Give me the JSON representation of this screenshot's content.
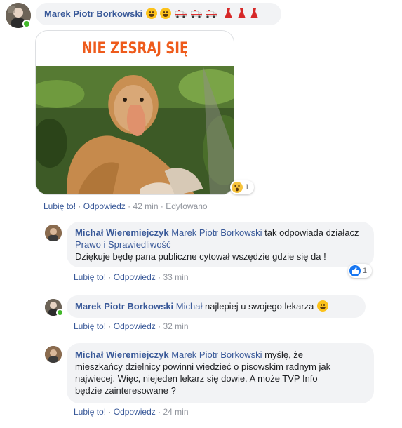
{
  "comment1": {
    "author": "Marek Piotr Borkowski",
    "emoji_sequence": [
      "grinning-face",
      "grinning-face",
      "ambulance",
      "ambulance",
      "ambulance",
      "red-dress",
      "red-dress",
      "red-dress"
    ],
    "image_caption": "NIE ZESRAJ SIĘ",
    "reaction": {
      "icon": "wow-face",
      "count": "1"
    },
    "actions": {
      "like": "Lubię to!",
      "reply": "Odpowiedz",
      "time": "42 min",
      "edited": "Edytowano"
    }
  },
  "reply1": {
    "author": "Michał Wieremiejczyk",
    "mention": "Marek Piotr Borkowski",
    "text_a": "tak odpowiada działacz",
    "page_link": "Prawo i Sprawiedliwość",
    "text_b": "Dziękuje będę pana publiczne cytował wszędzie gdzie się da !",
    "reaction": {
      "icon": "like-thumb",
      "count": "1"
    },
    "actions": {
      "like": "Lubię to!",
      "reply": "Odpowiedz",
      "time": "33 min"
    }
  },
  "reply2": {
    "author": "Marek Piotr Borkowski",
    "mention": "Michał",
    "text": "najlepiej u swojego lekarza",
    "emoji": "grinning-face",
    "actions": {
      "like": "Lubię to!",
      "reply": "Odpowiedz",
      "time": "32 min"
    }
  },
  "reply3": {
    "author": "Michał Wieremiejczyk",
    "mention": "Marek Piotr Borkowski",
    "text_line1": "myślę, że",
    "text_line2": "mieszkańcy dzielnicy powinni wiedzieć o pisowskim radnym jak",
    "text_line3": "najwiecej. Więc, niejeden lekarz się dowie. A może TVP Info",
    "text_line4": "będzie zainteresowane ?",
    "actions": {
      "like": "Lubię to!",
      "reply": "Odpowiedz",
      "time": "24 min"
    }
  },
  "colors": {
    "link": "#385898",
    "bubble": "#f2f3f5",
    "online": "#42b72a",
    "meme_title": "#ee5b1c"
  },
  "separator": "·"
}
